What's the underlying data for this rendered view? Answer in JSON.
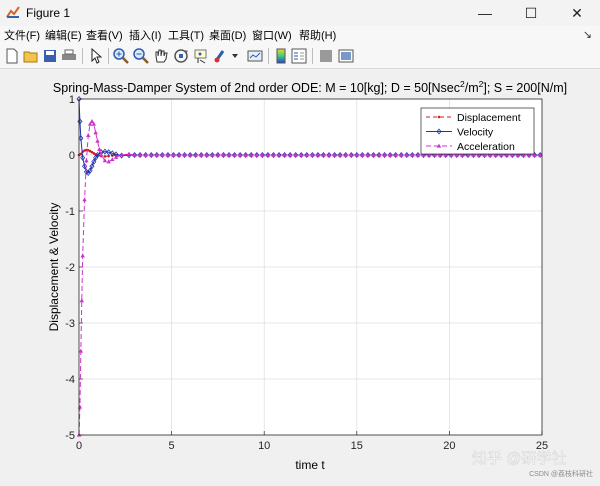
{
  "window": {
    "title": "Figure 1",
    "controls": {
      "minimize": "—",
      "maximize": "☐",
      "close": "✕"
    }
  },
  "menu": [
    "文件(F)",
    "编辑(E)",
    "查看(V)",
    "插入(I)",
    "工具(T)",
    "桌面(D)",
    "窗口(W)",
    "帮助(H)"
  ],
  "menu_overflow": "↘",
  "toolbar": [
    "new-figure-icon",
    "open-file-icon",
    "save-icon",
    "print-icon",
    "edit-plot-arrow-icon",
    "zoom-in-icon",
    "zoom-out-icon",
    "pan-hand-icon",
    "rotate-3d-icon",
    "data-cursor-icon",
    "brush-icon",
    "link-plot-icon",
    "colorbar-icon",
    "legend-icon",
    "hide-plot-tools-icon",
    "show-plot-tools-icon"
  ],
  "watermark": {
    "main": "知乎 @研学社",
    "sub": "CSDN @荔枝科研社"
  },
  "chart_data": {
    "type": "line",
    "title": "Spring-Mass-Damper System of 2nd order ODE:  M = 10[kg]; D = 50[Nsec²/m²]; S = 200[N/m]",
    "title_parts": {
      "p1": "Spring-Mass-Damper System of 2nd order ODE:  M = 10[kg]; D = 50[Nsec",
      "sup1": "2",
      "p2": "/m",
      "sup2": "2",
      "p3": "]; S = 200[N/m]"
    },
    "xlabel": "time t",
    "ylabel": "Displacement & Velocity",
    "xlim": [
      0,
      25
    ],
    "ylim": [
      -5,
      1
    ],
    "xticks": [
      0,
      5,
      10,
      15,
      20,
      25
    ],
    "yticks": [
      -5,
      -4,
      -3,
      -2,
      -1,
      0,
      1
    ],
    "grid": true,
    "legend_position": "top-right",
    "series": [
      {
        "name": "Displacement",
        "color": "#cc2222",
        "marker": "dot",
        "dash": "4,3",
        "points": [
          [
            0,
            0
          ],
          [
            0.1,
            0.02
          ],
          [
            0.2,
            0.06
          ],
          [
            0.3,
            0.08
          ],
          [
            0.4,
            0.09
          ],
          [
            0.5,
            0.085
          ],
          [
            0.6,
            0.07
          ],
          [
            0.7,
            0.05
          ],
          [
            0.8,
            0.03
          ],
          [
            0.9,
            0.01
          ],
          [
            1.0,
            -0.005
          ],
          [
            1.2,
            -0.02
          ],
          [
            1.4,
            -0.025
          ],
          [
            1.6,
            -0.02
          ],
          [
            1.8,
            -0.01
          ],
          [
            2.0,
            -0.003
          ],
          [
            2.3,
            0.003
          ],
          [
            2.7,
            0.002
          ],
          [
            3.0,
            0
          ],
          [
            25,
            0
          ]
        ]
      },
      {
        "name": "Velocity",
        "color": "#2233aa",
        "marker": "diamond",
        "dash": "",
        "points": [
          [
            0,
            1
          ],
          [
            0.05,
            0.6
          ],
          [
            0.1,
            0.3
          ],
          [
            0.2,
            -0.05
          ],
          [
            0.3,
            -0.2
          ],
          [
            0.4,
            -0.3
          ],
          [
            0.5,
            -0.32
          ],
          [
            0.6,
            -0.28
          ],
          [
            0.7,
            -0.2
          ],
          [
            0.8,
            -0.12
          ],
          [
            0.9,
            -0.05
          ],
          [
            1.0,
            0
          ],
          [
            1.2,
            0.05
          ],
          [
            1.4,
            0.06
          ],
          [
            1.6,
            0.05
          ],
          [
            1.8,
            0.03
          ],
          [
            2.0,
            0.01
          ],
          [
            2.3,
            -0.01
          ],
          [
            2.7,
            -0.005
          ],
          [
            3.0,
            0
          ],
          [
            25,
            0
          ]
        ]
      },
      {
        "name": "Acceleration",
        "color": "#cc33cc",
        "marker": "triangle",
        "dash": "5,3",
        "points": [
          [
            0,
            -5
          ],
          [
            0.05,
            -4.5
          ],
          [
            0.1,
            -3.5
          ],
          [
            0.15,
            -2.6
          ],
          [
            0.2,
            -1.8
          ],
          [
            0.3,
            -0.8
          ],
          [
            0.4,
            -0.1
          ],
          [
            0.5,
            0.35
          ],
          [
            0.6,
            0.55
          ],
          [
            0.7,
            0.6
          ],
          [
            0.8,
            0.55
          ],
          [
            0.9,
            0.4
          ],
          [
            1.0,
            0.25
          ],
          [
            1.1,
            0.1
          ],
          [
            1.2,
            0
          ],
          [
            1.4,
            -0.1
          ],
          [
            1.6,
            -0.12
          ],
          [
            1.8,
            -0.08
          ],
          [
            2.0,
            -0.04
          ],
          [
            2.3,
            0
          ],
          [
            2.7,
            0.02
          ],
          [
            3.0,
            0
          ],
          [
            25,
            0
          ]
        ]
      }
    ]
  }
}
